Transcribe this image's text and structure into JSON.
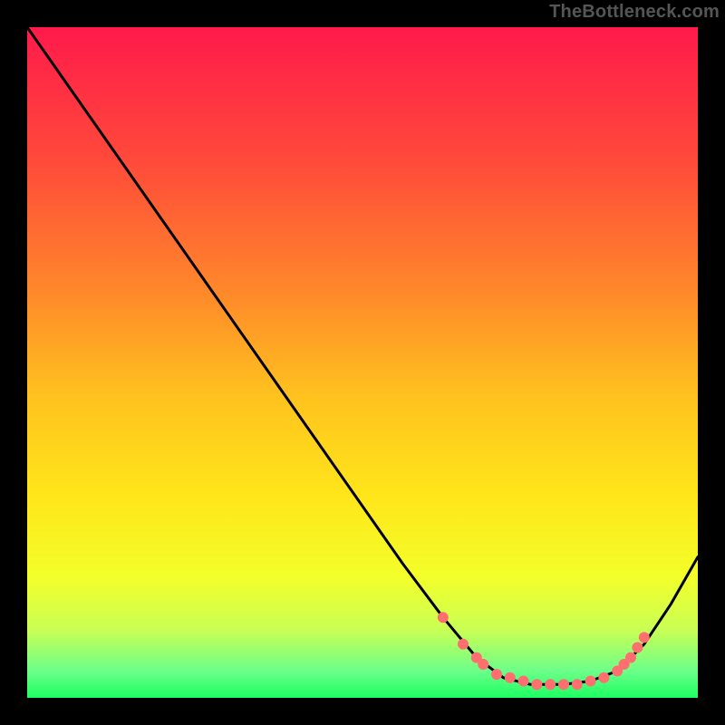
{
  "watermark": "TheBottleneck.com",
  "chart_data": {
    "type": "line",
    "title": "",
    "xlabel": "",
    "ylabel": "",
    "xlim": [
      0,
      100
    ],
    "ylim": [
      0,
      100
    ],
    "grid": false,
    "legend": false,
    "gradient_stops": [
      {
        "offset": 0,
        "color": "#ff1a4b"
      },
      {
        "offset": 0.2,
        "color": "#ff4a3a"
      },
      {
        "offset": 0.4,
        "color": "#ff8a2a"
      },
      {
        "offset": 0.55,
        "color": "#ffc21e"
      },
      {
        "offset": 0.7,
        "color": "#ffe61a"
      },
      {
        "offset": 0.82,
        "color": "#f3ff2a"
      },
      {
        "offset": 0.9,
        "color": "#c8ff55"
      },
      {
        "offset": 0.96,
        "color": "#6cff89"
      },
      {
        "offset": 1.0,
        "color": "#1cff62"
      }
    ],
    "curve": [
      {
        "x": 0,
        "y": 100
      },
      {
        "x": 7,
        "y": 90
      },
      {
        "x": 14,
        "y": 80
      },
      {
        "x": 21,
        "y": 70
      },
      {
        "x": 28,
        "y": 60
      },
      {
        "x": 35,
        "y": 50
      },
      {
        "x": 42,
        "y": 40
      },
      {
        "x": 49,
        "y": 30
      },
      {
        "x": 56,
        "y": 20
      },
      {
        "x": 62,
        "y": 12
      },
      {
        "x": 67,
        "y": 6
      },
      {
        "x": 71,
        "y": 3
      },
      {
        "x": 75,
        "y": 2
      },
      {
        "x": 80,
        "y": 2
      },
      {
        "x": 84,
        "y": 2.5
      },
      {
        "x": 88,
        "y": 4
      },
      {
        "x": 92,
        "y": 8
      },
      {
        "x": 96,
        "y": 14
      },
      {
        "x": 100,
        "y": 21
      }
    ],
    "markers": [
      {
        "x": 62,
        "y": 12
      },
      {
        "x": 65,
        "y": 8
      },
      {
        "x": 67,
        "y": 6
      },
      {
        "x": 68,
        "y": 5
      },
      {
        "x": 70,
        "y": 3.5
      },
      {
        "x": 72,
        "y": 3
      },
      {
        "x": 74,
        "y": 2.5
      },
      {
        "x": 76,
        "y": 2
      },
      {
        "x": 78,
        "y": 2
      },
      {
        "x": 80,
        "y": 2
      },
      {
        "x": 82,
        "y": 2
      },
      {
        "x": 84,
        "y": 2.5
      },
      {
        "x": 86,
        "y": 3
      },
      {
        "x": 88,
        "y": 4
      },
      {
        "x": 89,
        "y": 5
      },
      {
        "x": 90,
        "y": 6
      },
      {
        "x": 91,
        "y": 7.5
      },
      {
        "x": 92,
        "y": 9
      }
    ],
    "marker_color": "#ff6f6f",
    "line_color": "#000000"
  }
}
